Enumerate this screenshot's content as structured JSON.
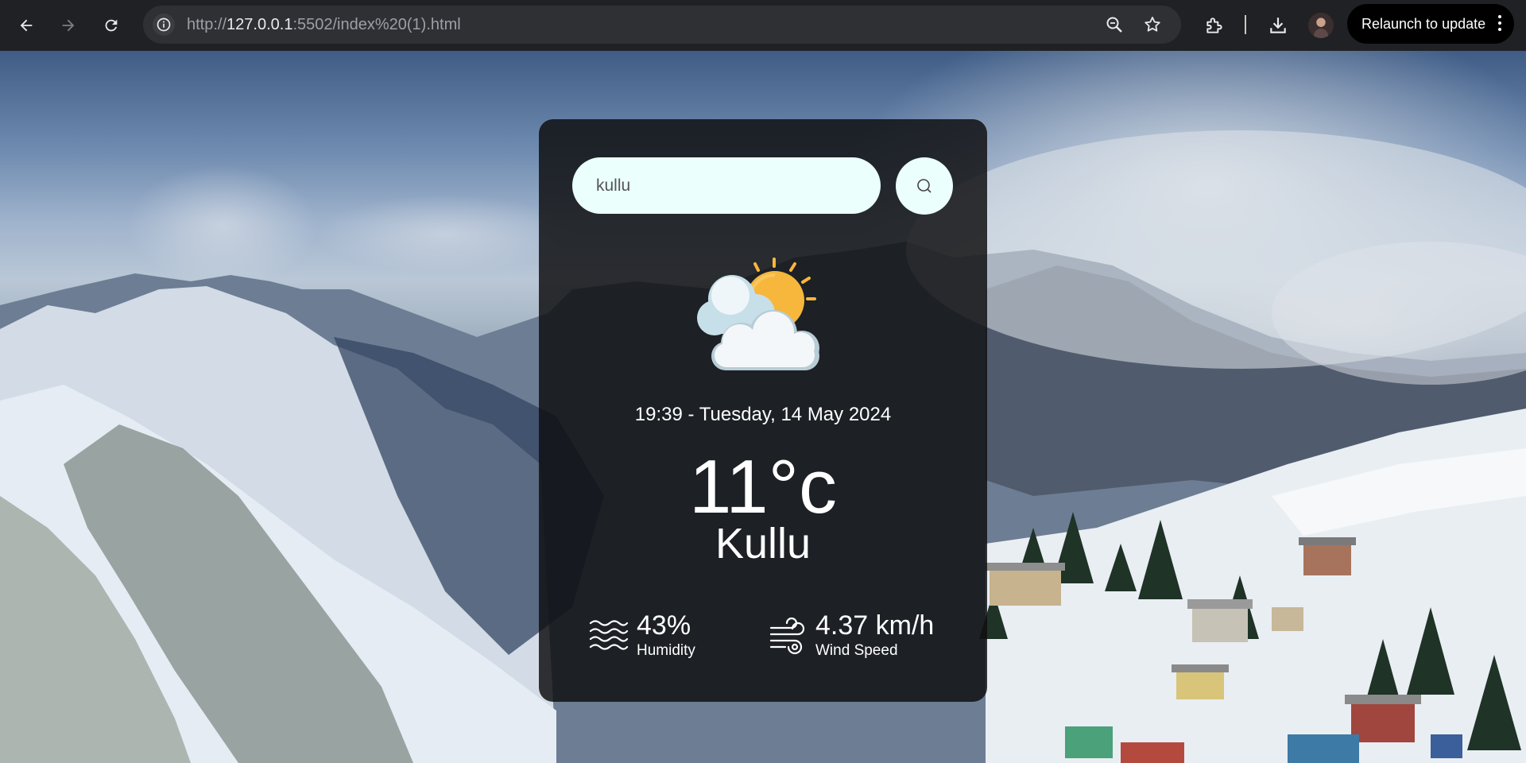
{
  "browser": {
    "url_prefix": "http://",
    "url_host": "127.0.0.1",
    "url_rest": ":5502/index%20(1).html",
    "relaunch_label": "Relaunch to update",
    "icons": [
      "back-arrow-icon",
      "forward-arrow-icon",
      "reload-icon",
      "info-icon",
      "zoom-icon",
      "star-icon",
      "extensions-icon",
      "download-icon",
      "profile-avatar",
      "more-vert-icon"
    ]
  },
  "weather": {
    "search": {
      "value": "kullu",
      "icon": "search-icon"
    },
    "condition_icon": "partly-cloudy-sun-icon",
    "datetime": "19:39 - Tuesday, 14 May 2024",
    "temperature": "11°c",
    "city": "Kullu",
    "humidity": {
      "value": "43%",
      "label": "Humidity",
      "icon": "humidity-waves-icon"
    },
    "wind": {
      "value": "4.37 km/h",
      "label": "Wind Speed",
      "icon": "wind-icon"
    }
  },
  "colors": {
    "chrome_bg": "#202124",
    "omnibox_bg": "#2f3033",
    "card_bg": "rgba(14,14,16,0.84)",
    "input_bg": "#ebfffc",
    "sun": "#f6b73c",
    "cloud": "#eef3f6"
  }
}
